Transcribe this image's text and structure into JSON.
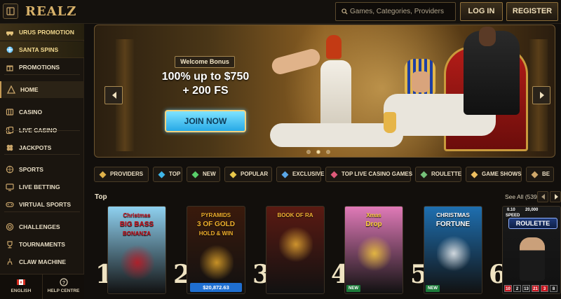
{
  "header": {
    "logo": "REALZ",
    "search_placeholder": "Games, Categories, Providers",
    "login_label": "LOG IN",
    "register_label": "REGISTER"
  },
  "sidebar": {
    "items": [
      {
        "label": "URUS PROMOTION",
        "icon": "car-icon",
        "kind": "promo"
      },
      {
        "label": "SANTA SPINS",
        "icon": "snowflake-icon",
        "kind": "promo"
      },
      {
        "label": "PROMOTIONS",
        "icon": "gift-icon",
        "kind": "normal"
      },
      {
        "label": "HOME",
        "icon": "pyramid-icon",
        "kind": "active"
      },
      {
        "label": "CASINO",
        "icon": "slot-icon",
        "kind": "normal"
      },
      {
        "label": "LIVE CASINO",
        "icon": "cards-icon",
        "kind": "normal"
      },
      {
        "label": "JACKPOTS",
        "icon": "clover-icon",
        "kind": "normal"
      },
      {
        "label": "SPORTS",
        "icon": "ball-icon",
        "kind": "normal"
      },
      {
        "label": "LIVE BETTING",
        "icon": "monitor-icon",
        "kind": "normal"
      },
      {
        "label": "VIRTUAL SPORTS",
        "icon": "gamepad-icon",
        "kind": "normal"
      },
      {
        "label": "CHALLENGES",
        "icon": "target-icon",
        "kind": "normal"
      },
      {
        "label": "TOURNAMENTS",
        "icon": "trophy-icon",
        "kind": "normal"
      },
      {
        "label": "CLAW MACHINE",
        "icon": "claw-icon",
        "kind": "normal"
      }
    ],
    "language_label": "ENGLISH",
    "help_label": "HELP CENTRE"
  },
  "hero": {
    "badge": "Welcome Bonus",
    "headline_line1": "100% up to $750",
    "headline_line2": "+ 200 FS",
    "cta": "JOIN NOW",
    "slide_count": 3,
    "active_slide": 1
  },
  "categories": [
    {
      "label": "PROVIDERS",
      "icon": "providers-icon"
    },
    {
      "label": "TOP",
      "icon": "diamond-icon"
    },
    {
      "label": "NEW",
      "icon": "lightning-icon"
    },
    {
      "label": "POPULAR",
      "icon": "star-icon"
    },
    {
      "label": "EXCLUSIVE",
      "icon": "crown-icon"
    },
    {
      "label": "TOP LIVE CASINO GAMES",
      "icon": "dealer-icon"
    },
    {
      "label": "ROULETTE",
      "icon": "roulette-icon"
    },
    {
      "label": "GAME SHOWS",
      "icon": "microphone-icon"
    },
    {
      "label": "BE",
      "icon": "bet-icon"
    }
  ],
  "top_section": {
    "title": "Top",
    "see_all": "See All (539)",
    "games": [
      {
        "rank": "1",
        "title_lines": [
          "Christmas",
          "BIG BASS",
          "BONANZA"
        ],
        "bg": "#8fd1f0",
        "accent": "#c8141e"
      },
      {
        "rank": "2",
        "title_lines": [
          "PYRAMIDS",
          "3 OF GOLD",
          "HOLD & WIN"
        ],
        "bg": "#3a1a0c",
        "accent": "#f0b02c",
        "price": "$20,872.63"
      },
      {
        "rank": "3",
        "title_lines": [
          "BOOK OF RA"
        ],
        "bg": "#5a1a12",
        "accent": "#f2b234"
      },
      {
        "rank": "4",
        "title_lines": [
          "Xmas",
          "Drop"
        ],
        "bg": "#e07ab8",
        "accent": "#ffd23a",
        "badge": "NEW"
      },
      {
        "rank": "5",
        "title_lines": [
          "CHRISTMAS",
          "FORTUNE"
        ],
        "bg": "#1e6fb0",
        "accent": "#ffffff",
        "badge": "NEW"
      },
      {
        "rank": "6",
        "title_lines": [
          "SPEED",
          "ROULETTE"
        ],
        "bg": "#1a1a1a",
        "accent": "#ffffff",
        "roulette_stats": [
          "0.10",
          "20,000"
        ],
        "numbers": [
          "10",
          "2",
          "13",
          "21",
          "3",
          "8"
        ]
      }
    ]
  }
}
